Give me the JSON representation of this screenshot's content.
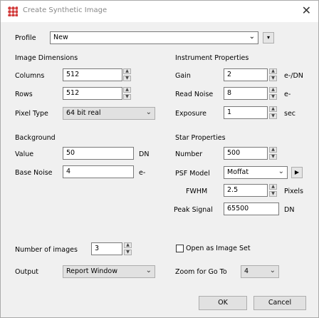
{
  "window": {
    "title": "Create Synthetic Image",
    "close_icon": "close-icon",
    "app_icon": "app-dot-grid-icon"
  },
  "profile": {
    "label": "Profile",
    "value": "New"
  },
  "image_dimensions": {
    "heading": "Image Dimensions",
    "columns_label": "Columns",
    "columns_value": "512",
    "rows_label": "Rows",
    "rows_value": "512",
    "pixel_type_label": "Pixel Type",
    "pixel_type_value": "64 bit real"
  },
  "background": {
    "heading": "Background",
    "value_label": "Value",
    "value_value": "50",
    "value_unit": "DN",
    "noise_label": "Base Noise",
    "noise_value": "4",
    "noise_unit": "e-"
  },
  "instrument": {
    "heading": "Instrument Properties",
    "gain_label": "Gain",
    "gain_value": "2",
    "gain_unit": "e-/DN",
    "read_noise_label": "Read Noise",
    "read_noise_value": "8",
    "read_noise_unit": "e-",
    "exposure_label": "Exposure",
    "exposure_value": "1",
    "exposure_unit": "sec"
  },
  "stars": {
    "heading": "Star Properties",
    "number_label": "Number",
    "number_value": "500",
    "psf_label": "PSF Model",
    "psf_value": "Moffat",
    "fwhm_label": "FWHM",
    "fwhm_value": "2.5",
    "fwhm_unit": "Pixels",
    "peak_label": "Peak Signal",
    "peak_value": "65500",
    "peak_unit": "DN"
  },
  "bottom": {
    "num_images_label": "Number of images",
    "num_images_value": "3",
    "output_label": "Output",
    "output_value": "Report Window",
    "image_set_label": "Open as Image Set",
    "zoom_label": "Zoom for Go To",
    "zoom_value": "4"
  },
  "buttons": {
    "ok": "OK",
    "cancel": "Cancel"
  }
}
